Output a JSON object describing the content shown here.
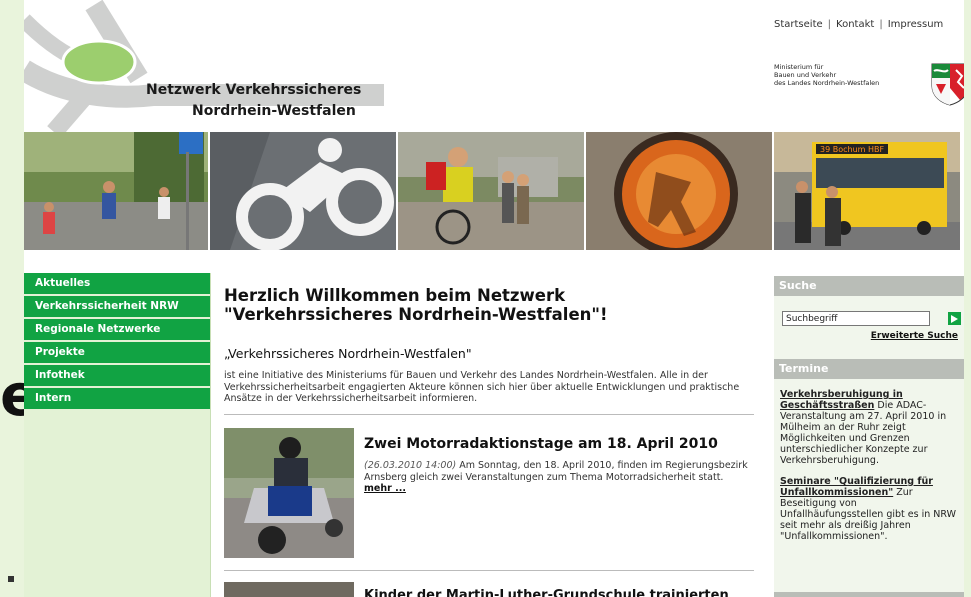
{
  "header": {
    "logo_line1": "Netzwerk Verkehrssicheres",
    "logo_line2": "Nordrhein-Westfalen",
    "topnav": [
      "Startseite",
      "Kontakt",
      "Impressum"
    ],
    "ministry_lines": [
      "Ministerium für",
      "Bauen und Verkehr",
      "des Landes Nordrhein-Westfalen"
    ]
  },
  "leftnav": {
    "items": [
      "Aktuelles",
      "Verkehrssicherheit NRW",
      "Regionale Netzwerke",
      "Projekte",
      "Infothek",
      "Intern"
    ]
  },
  "main": {
    "welcome_line1": "Herzlich Willkommen beim Netzwerk",
    "welcome_line2": "\"Verkehrssicheres Nordrhein-Westfalen\"!",
    "subhead": "„Verkehrssicheres Nordrhein-Westfalen\"",
    "intro": "ist eine Initiative des Ministeriums für Bauen und Verkehr des Landes Nordrhein-Westfalen. Alle in der Verkehrssicherheitsarbeit engagierten Akteure können sich hier über aktuelle Entwicklungen und praktische Ansätze in der Verkehrssicherheitsarbeit informieren.",
    "news": [
      {
        "title": "Zwei Motorradaktionstage am 18. April 2010",
        "date": "(26.03.2010 14:00)",
        "text": " Am Sonntag, den 18. April 2010, finden im Regierungsbezirk Arnsberg gleich zwei Veranstaltungen zum Thema Motorradsicherheit statt.",
        "more": "mehr ..."
      },
      {
        "title": "Kinder der Martin-Luther-Grundschule trainierten"
      }
    ]
  },
  "sidebar": {
    "search_head": "Suche",
    "search_placeholder": "Suchbegriff",
    "extended_search": "Erweiterte Suche",
    "termine_head": "Termine",
    "termine": [
      {
        "link": "Verkehrsberuhigung in Geschäftsstraßen",
        "text": " Die ADAC-Veranstaltung am 27. April 2010 in Mülheim an der Ruhr zeigt Möglichkeiten und Grenzen unterschiedlicher Konzepte zur Verkehrsberuhigung."
      },
      {
        "link": "Seminare \"Qualifizierung für Unfallkommissionen\"",
        "text": " Zur Beseitigung von Unfallhäufungsstellen gibt es in NRW seit mehr als dreißig Jahren \"Unfallkommissionen\"."
      }
    ]
  },
  "banner": {
    "bus_sign": "39 Bochum HBF"
  },
  "colors": {
    "nav_green": "#11a343",
    "page_bg": "#e9f4dc",
    "sidebar_head_grey": "#b9bdb7"
  }
}
